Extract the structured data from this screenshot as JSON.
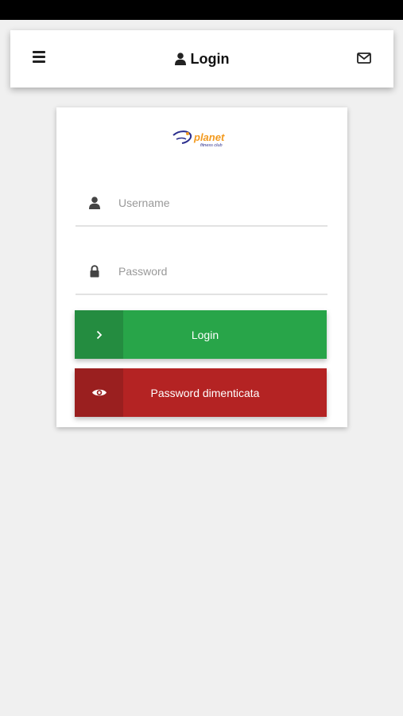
{
  "header": {
    "title": "Login",
    "menu_icon": "hamburger-menu-icon",
    "title_icon": "user-icon",
    "mail_icon": "envelope-icon"
  },
  "logo": {
    "text": "planet",
    "subtext": "fitness club",
    "colors": {
      "primary": "#2c2f8e",
      "accent": "#f39a1e"
    }
  },
  "form": {
    "username": {
      "placeholder": "Username",
      "value": "",
      "icon": "user-icon"
    },
    "password": {
      "placeholder": "Password",
      "value": "",
      "icon": "lock-icon"
    }
  },
  "buttons": {
    "login": {
      "label": "Login",
      "icon": "chevron-right-icon",
      "color": "#28a549"
    },
    "forgot": {
      "label": "Password dimenticata",
      "icon": "eye-icon",
      "color": "#b42323"
    }
  }
}
